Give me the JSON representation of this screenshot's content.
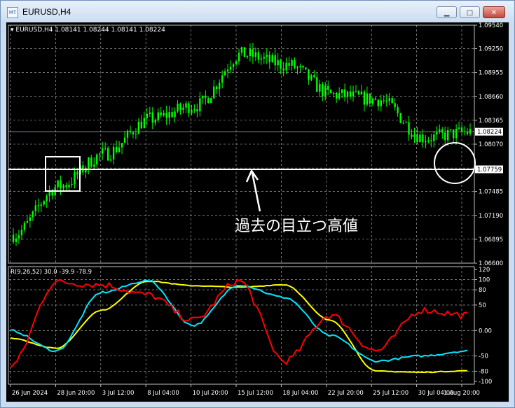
{
  "window": {
    "title": "EURUSD,H4"
  },
  "controls": {
    "minimize_icon": "minimize-icon",
    "maximize_icon": "maximize-icon",
    "close_icon": "close-icon"
  },
  "main_chart": {
    "info_label": "EURUSD,H4  1.08141 1.08244 1.08141 1.08224",
    "current_price_label": "1.08224",
    "level_label": "1.07759",
    "annotation": "過去の目立つ高値",
    "price_axis": [
      "1.09540",
      "1.09250",
      "1.08955",
      "1.08660",
      "1.08365",
      "1.08070",
      "1.07775",
      "1.07485",
      "1.07190",
      "1.06895",
      "1.06600"
    ]
  },
  "indicator": {
    "info_label": "R(9,26,52) 30.0 -39.9 -78.9",
    "axis": [
      "120",
      "100",
      "80",
      "50",
      "0.00",
      "-50",
      "-80",
      "-100"
    ]
  },
  "time_axis": [
    "26 Jun 2024",
    "28 Jun 20:00",
    "3 Jul 12:00",
    "8 Jul 04:00",
    "10 Jul 20:00",
    "15 Jul 12:00",
    "18 Jul 04:00",
    "22 Jul 20:00",
    "25 Jul 12:00",
    "30 Jul 04:00",
    "1 Aug 20:00"
  ],
  "colors": {
    "candles": "#00ff00",
    "level_line": "#ffffff",
    "grid": "#c0c0c0",
    "rsi_fast": "#ff0000",
    "rsi_mid": "#00e5ff",
    "rsi_slow": "#ffff00"
  },
  "chart_data": {
    "type": "line",
    "title": "EURUSD,H4",
    "price": {
      "ylim": [
        1.066,
        1.0954
      ],
      "x": [
        "26 Jun 2024",
        "28 Jun 20:00",
        "3 Jul 12:00",
        "8 Jul 04:00",
        "10 Jul 20:00",
        "15 Jul 12:00",
        "18 Jul 04:00",
        "22 Jul 20:00",
        "25 Jul 12:00",
        "30 Jul 04:00",
        "1 Aug 20:00"
      ],
      "values": [
        1.0695,
        1.0755,
        1.0795,
        1.0838,
        1.0855,
        1.0918,
        1.0905,
        1.0868,
        1.0862,
        1.0815,
        1.0822
      ],
      "level": 1.07759,
      "last": 1.08224
    },
    "indicator": {
      "ylim": [
        -100,
        120
      ],
      "x": [
        "26 Jun 2024",
        "28 Jun 20:00",
        "3 Jul 12:00",
        "8 Jul 04:00",
        "10 Jul 20:00",
        "15 Jul 12:00",
        "18 Jul 04:00",
        "22 Jul 20:00",
        "25 Jul 12:00",
        "30 Jul 04:00",
        "1 Aug 20:00"
      ],
      "series": [
        {
          "values": [
            -70,
            95,
            90,
            70,
            20,
            98,
            -60,
            30,
            -40,
            40,
            30
          ]
        },
        {
          "values": [
            0,
            -40,
            75,
            98,
            10,
            90,
            65,
            -10,
            -60,
            -50,
            -40
          ]
        },
        {
          "values": [
            -15,
            -35,
            40,
            97,
            88,
            85,
            90,
            20,
            -80,
            -82,
            -79
          ]
        }
      ]
    }
  }
}
